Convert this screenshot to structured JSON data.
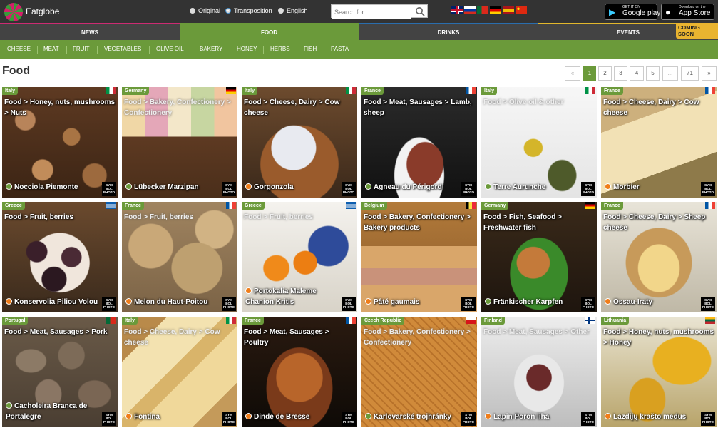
{
  "brand": {
    "name": "Eatglobe"
  },
  "header": {
    "radio": [
      {
        "label": "Original",
        "selected": false
      },
      {
        "label": "Transposition",
        "selected": true
      },
      {
        "label": "English",
        "selected": false
      }
    ],
    "search_placeholder": "Search for...",
    "languages": [
      "gb-flag-icon",
      "ru-flag-icon",
      "pt-flag-icon",
      "de-flag-icon",
      "es-flag-icon",
      "cn-flag-icon"
    ],
    "google_play": {
      "line1": "GET IT ON",
      "line2": "Google play"
    },
    "app_store": {
      "line1": "Download on the",
      "line2": "App Store"
    }
  },
  "nav": {
    "tabs": [
      "NEWS",
      "FOOD",
      "DRINKS",
      "EVENTS"
    ],
    "active": "FOOD",
    "coming_soon": "COMING SOON"
  },
  "subnav": [
    "CHEESE",
    "MEAT",
    "FRUIT",
    "VEGETABLES",
    "OLIVE OIL",
    "BAKERY",
    "HONEY",
    "HERBS",
    "FISH",
    "PASTA"
  ],
  "page_title": "Food",
  "pagination": {
    "prev": "«",
    "pages": [
      "1",
      "2",
      "3",
      "4",
      "5"
    ],
    "ellipsis": "...",
    "last": "71",
    "next": "»",
    "current": "1"
  },
  "symbol_photo": "SYM BOL PHOTO",
  "colors": {
    "accent": "#6b9a3a",
    "news": "#cc2b72",
    "drinks": "#2a6dad",
    "events": "#e2b72c"
  },
  "cards": [
    {
      "country": "Italy",
      "flag": "it",
      "category": "Food > Honey, nuts, mushrooms > Nuts",
      "name": "Nocciola Piemonte",
      "bullet": "#6b9a3a",
      "bg": "nuts"
    },
    {
      "country": "Germany",
      "flag": "de",
      "category": "Food > Bakery, Confectionery > Confectionery",
      "name": "Lübecker Marzipan",
      "bullet": "#6b9a3a",
      "bg": "marzipan",
      "light": true
    },
    {
      "country": "Italy",
      "flag": "it",
      "category": "Food > Cheese, Dairy > Cow cheese",
      "name": "Gorgonzola",
      "bullet": "#f07d1a",
      "bg": "gorgonzola"
    },
    {
      "country": "France",
      "flag": "fr",
      "category": "Food > Meat, Sausages > Lamb, sheep",
      "name": "Agneau du Périgord",
      "bullet": "#6b9a3a",
      "bg": "lamb"
    },
    {
      "country": "Italy",
      "flag": "it",
      "category": "Food > Olive oil & other",
      "name": "Terre Aurunche",
      "bullet": "#6b9a3a",
      "bg": "oil",
      "light": true
    },
    {
      "country": "France",
      "flag": "fr",
      "category": "Food > Cheese, Dairy > Cow cheese",
      "name": "Morbier",
      "bullet": "#f07d1a",
      "bg": "morbier"
    },
    {
      "country": "Greece",
      "flag": "gr",
      "category": "Food > Fruit, berries",
      "name": "Konservolia Piliou Volou",
      "bullet": "#f07d1a",
      "bg": "olives"
    },
    {
      "country": "France",
      "flag": "fr",
      "category": "Food > Fruit, berries",
      "name": "Melon du Haut-Poitou",
      "bullet": "#f07d1a",
      "bg": "melon",
      "light": true
    },
    {
      "country": "Greece",
      "flag": "gr",
      "category": "Food > Fruit, berries",
      "name": "Portokalia Maleme Chanion Kritis",
      "bullet": "#f07d1a",
      "bg": "oranges",
      "light": true
    },
    {
      "country": "Belgium",
      "flag": "be",
      "category": "Food > Bakery, Confectionery > Bakery products",
      "name": "Pâté gaumais",
      "bullet": "#f07d1a",
      "bg": "pate"
    },
    {
      "country": "Germany",
      "flag": "de",
      "category": "Food > Fish, Seafood > Freshwater fish",
      "name": "Fränkischer Karpfen",
      "bullet": "#6b9a3a",
      "bg": "fish"
    },
    {
      "country": "France",
      "flag": "fr",
      "category": "Food > Cheese, Dairy > Sheep cheese",
      "name": "Ossau-Iraty",
      "bullet": "#f07d1a",
      "bg": "ossau"
    },
    {
      "country": "Portugal",
      "flag": "pt",
      "category": "Food > Meat, Sausages > Pork",
      "name": "Cacholeira Branca de Portalegre",
      "bullet": "#6b9a3a",
      "bg": "sausage"
    },
    {
      "country": "Italy",
      "flag": "it",
      "category": "Food > Cheese, Dairy > Cow cheese",
      "name": "Fontina",
      "bullet": "#f07d1a",
      "bg": "fontina",
      "light": true
    },
    {
      "country": "France",
      "flag": "fr",
      "category": "Food > Meat, Sausages > Poultry",
      "name": "Dinde de Bresse",
      "bullet": "#f07d1a",
      "bg": "turkey"
    },
    {
      "country": "Czech Republic",
      "flag": "cz",
      "category": "Food > Bakery, Confectionery > Confectionery",
      "name": "Karlovarské trojhránky",
      "bullet": "#6b9a3a",
      "bg": "waffle",
      "light": true
    },
    {
      "country": "Finland",
      "flag": "fi",
      "category": "Food > Meat, Sausages > Other",
      "name": "Lapin Poron liha",
      "bullet": "#f07d1a",
      "bg": "reindeer",
      "light": true
    },
    {
      "country": "Lithuania",
      "flag": "lt",
      "category": "Food > Honey, nuts, mushrooms > Honey",
      "name": "Lazdijų krašto medus",
      "bullet": "#f07d1a",
      "bg": "honey"
    }
  ]
}
